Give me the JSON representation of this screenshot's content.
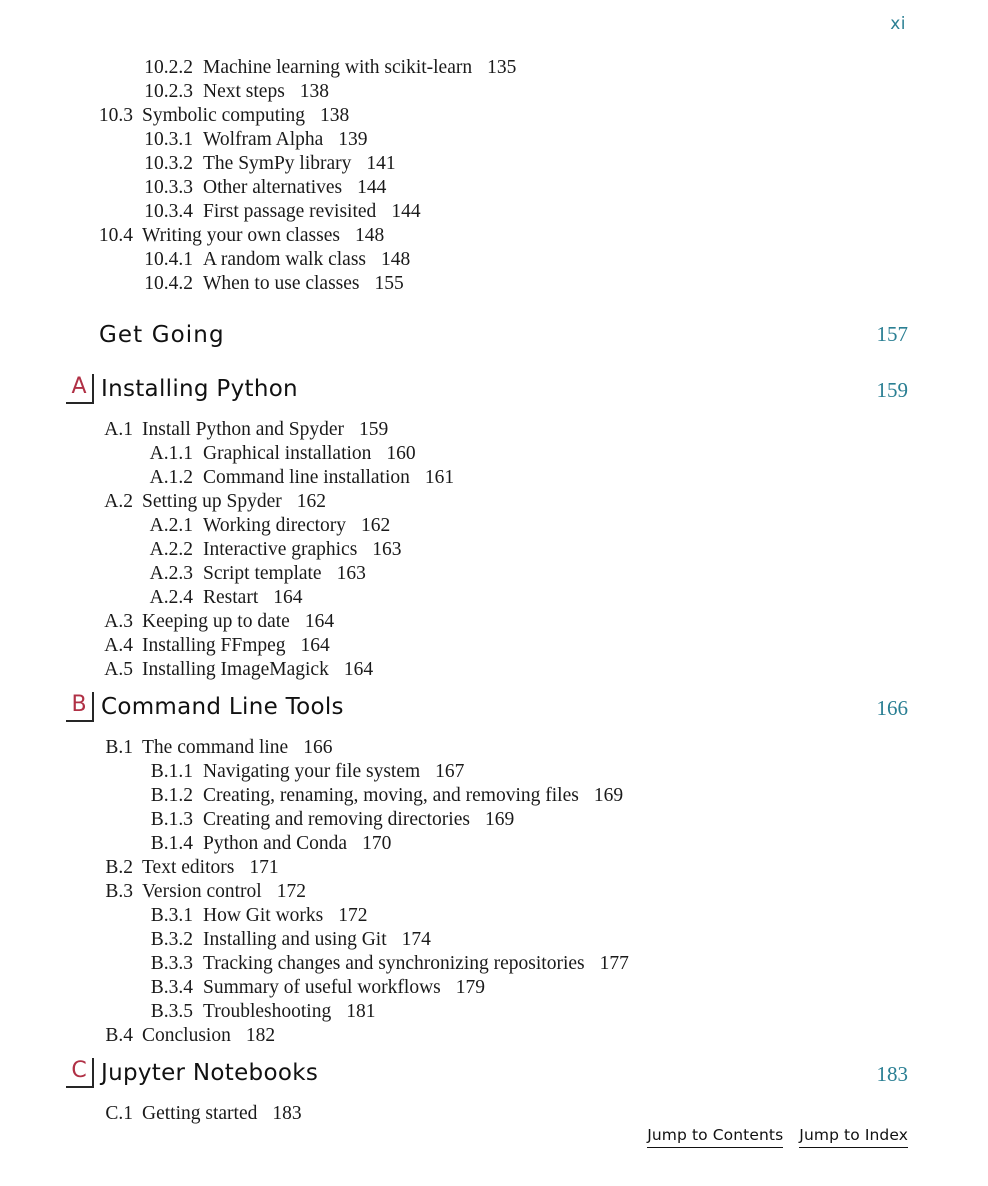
{
  "folio": "xi",
  "toc_continued": [
    {
      "level": 3,
      "num": "10.2.2",
      "title": "Machine learning with scikit-learn",
      "page": "135"
    },
    {
      "level": 3,
      "num": "10.2.3",
      "title": "Next steps",
      "page": "138"
    },
    {
      "level": 2,
      "num": "10.3",
      "title": "Symbolic computing",
      "page": "138"
    },
    {
      "level": 3,
      "num": "10.3.1",
      "title": "Wolfram Alpha",
      "page": "139"
    },
    {
      "level": 3,
      "num": "10.3.2",
      "title": "The SymPy library",
      "page": "141"
    },
    {
      "level": 3,
      "num": "10.3.3",
      "title": "Other alternatives",
      "page": "144"
    },
    {
      "level": 3,
      "num": "10.3.4",
      "title": "First passage revisited",
      "page": "144"
    },
    {
      "level": 2,
      "num": "10.4",
      "title": "Writing your own classes",
      "page": "148"
    },
    {
      "level": 3,
      "num": "10.4.1",
      "title": "A random walk class",
      "page": "148"
    },
    {
      "level": 3,
      "num": "10.4.2",
      "title": "When to use classes",
      "page": "155"
    }
  ],
  "part": {
    "title": "Get Going",
    "page": "157"
  },
  "appendices": [
    {
      "letter": "A",
      "title": "Installing Python",
      "page": "159",
      "entries": [
        {
          "level": 2,
          "num": "A.1",
          "title": "Install Python and Spyder",
          "page": "159"
        },
        {
          "level": 3,
          "num": "A.1.1",
          "title": "Graphical installation",
          "page": "160"
        },
        {
          "level": 3,
          "num": "A.1.2",
          "title": "Command line installation",
          "page": "161"
        },
        {
          "level": 2,
          "num": "A.2",
          "title": "Setting up Spyder",
          "page": "162"
        },
        {
          "level": 3,
          "num": "A.2.1",
          "title": "Working directory",
          "page": "162"
        },
        {
          "level": 3,
          "num": "A.2.2",
          "title": "Interactive graphics",
          "page": "163"
        },
        {
          "level": 3,
          "num": "A.2.3",
          "title": "Script template",
          "page": "163"
        },
        {
          "level": 3,
          "num": "A.2.4",
          "title": "Restart",
          "page": "164"
        },
        {
          "level": 2,
          "num": "A.3",
          "title": "Keeping up to date",
          "page": "164"
        },
        {
          "level": 2,
          "num": "A.4",
          "title": "Installing FFmpeg",
          "page": "164"
        },
        {
          "level": 2,
          "num": "A.5",
          "title": "Installing ImageMagick",
          "page": "164"
        }
      ]
    },
    {
      "letter": "B",
      "title": "Command Line Tools",
      "page": "166",
      "entries": [
        {
          "level": 2,
          "num": "B.1",
          "title": "The command line",
          "page": "166"
        },
        {
          "level": 3,
          "num": "B.1.1",
          "title": "Navigating your file system",
          "page": "167"
        },
        {
          "level": 3,
          "num": "B.1.2",
          "title": "Creating, renaming, moving, and removing files",
          "page": "169"
        },
        {
          "level": 3,
          "num": "B.1.3",
          "title": "Creating and removing directories",
          "page": "169"
        },
        {
          "level": 3,
          "num": "B.1.4",
          "title": "Python and Conda",
          "page": "170"
        },
        {
          "level": 2,
          "num": "B.2",
          "title": "Text editors",
          "page": "171"
        },
        {
          "level": 2,
          "num": "B.3",
          "title": "Version control",
          "page": "172"
        },
        {
          "level": 3,
          "num": "B.3.1",
          "title": "How Git works",
          "page": "172"
        },
        {
          "level": 3,
          "num": "B.3.2",
          "title": "Installing and using Git",
          "page": "174"
        },
        {
          "level": 3,
          "num": "B.3.3",
          "title": "Tracking changes and synchronizing repositories",
          "page": "177"
        },
        {
          "level": 3,
          "num": "B.3.4",
          "title": "Summary of useful workflows",
          "page": "179"
        },
        {
          "level": 3,
          "num": "B.3.5",
          "title": "Troubleshooting",
          "page": "181"
        },
        {
          "level": 2,
          "num": "B.4",
          "title": "Conclusion",
          "page": "182"
        }
      ]
    },
    {
      "letter": "C",
      "title": "Jupyter Notebooks",
      "page": "183",
      "entries": [
        {
          "level": 2,
          "num": "C.1",
          "title": "Getting started",
          "page": "183"
        }
      ]
    }
  ],
  "footer": {
    "links": [
      {
        "label": "Jump to Contents"
      },
      {
        "label": "Jump to Index"
      }
    ]
  },
  "colors": {
    "page_number": "#2a7f93",
    "appendix_letter": "#b03045",
    "text": "#1a1a1a"
  }
}
